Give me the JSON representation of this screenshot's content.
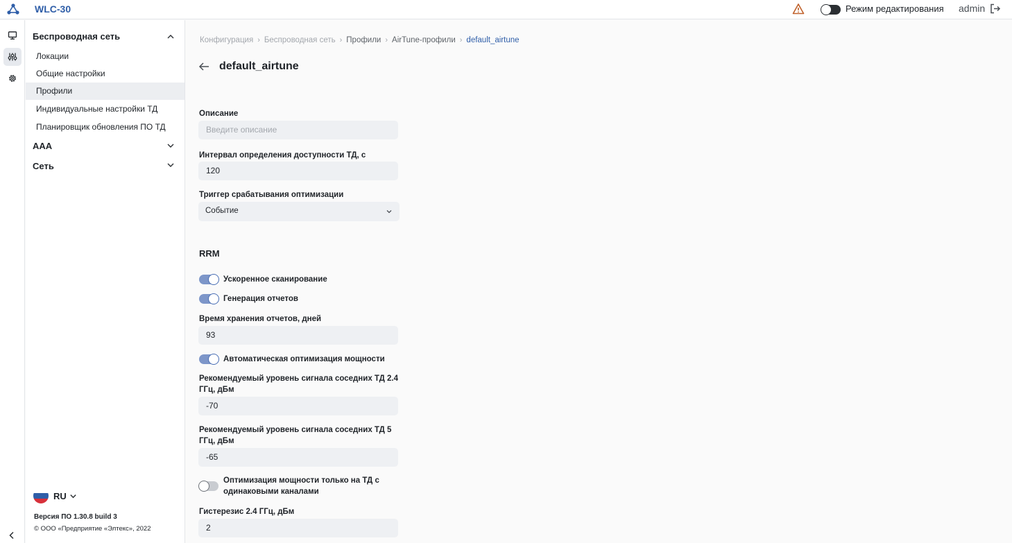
{
  "app": {
    "title": "WLC-30"
  },
  "topbar": {
    "edit_mode_label": "Режим редактирования",
    "edit_mode_on": false,
    "user": "admin"
  },
  "sidebar": {
    "sections": [
      {
        "label": "Беспроводная сеть",
        "expanded": true
      },
      {
        "label": "AAA",
        "expanded": false
      },
      {
        "label": "Сеть",
        "expanded": false
      }
    ],
    "items": [
      {
        "label": "Локации"
      },
      {
        "label": "Общие настройки"
      },
      {
        "label": "Профили",
        "active": true
      },
      {
        "label": "Индивидуальные настройки ТД"
      },
      {
        "label": "Планировщик обновления ПО ТД"
      }
    ],
    "language": "RU",
    "version": "Версия ПО 1.30.8 build 3",
    "copyright": "© ООО «Предприятие «Элтекс», 2022"
  },
  "breadcrumb": [
    "Конфигурация",
    "Беспроводная сеть",
    "Профили",
    "AirTune-профили",
    "default_airtune"
  ],
  "page": {
    "title": "default_airtune"
  },
  "form": {
    "description": {
      "label": "Описание",
      "placeholder": "Введите описание",
      "value": ""
    },
    "interval": {
      "label": "Интервал определения доступности ТД, с",
      "value": "120"
    },
    "trigger": {
      "label": "Триггер срабатывания оптимизации",
      "value": "Событие"
    },
    "rrm_title": "RRM",
    "fast_scan": {
      "label": "Ускоренное сканирование",
      "on": true
    },
    "report_gen": {
      "label": "Генерация отчетов",
      "on": true
    },
    "report_retention": {
      "label": "Время хранения отчетов, дней",
      "value": "93"
    },
    "auto_power": {
      "label": "Автоматическая оптимизация мощности",
      "on": true
    },
    "neighbor_24": {
      "label": "Рекомендуемый уровень сигнала соседних ТД 2.4 ГГц, дБм",
      "value": "-70"
    },
    "neighbor_5": {
      "label": "Рекомендуемый уровень сигнала соседних ТД 5 ГГц, дБм",
      "value": "-65"
    },
    "same_channel": {
      "label": "Оптимизация мощности только на ТД с одинаковыми каналами",
      "on": false
    },
    "hysteresis_24": {
      "label": "Гистерезис 2.4 ГГц, дБм",
      "value": "2"
    }
  },
  "colors": {
    "accent": "#2f5ea8",
    "toggle_on": "#7d96c9",
    "warning": "#c0612b"
  }
}
